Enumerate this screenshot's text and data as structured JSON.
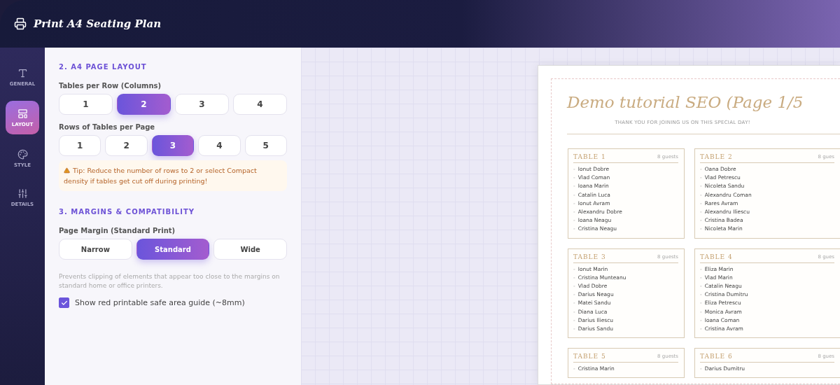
{
  "header": {
    "title": "Print A4 Seating Plan"
  },
  "sidebar": {
    "items": [
      {
        "label": "GENERAL",
        "selected": false
      },
      {
        "label": "LAYOUT",
        "selected": true
      },
      {
        "label": "STYLE",
        "selected": false
      },
      {
        "label": "DETAILS",
        "selected": false
      }
    ]
  },
  "settings": {
    "layout_heading": "2. A4 PAGE LAYOUT",
    "columns": {
      "label": "Tables per Row (Columns)",
      "options": [
        {
          "label": "1",
          "selected": false
        },
        {
          "label": "2",
          "selected": true
        },
        {
          "label": "3",
          "selected": false
        },
        {
          "label": "4",
          "selected": false
        }
      ]
    },
    "rows": {
      "label": "Rows of Tables per Page",
      "options": [
        {
          "label": "1",
          "selected": false
        },
        {
          "label": "2",
          "selected": false
        },
        {
          "label": "3",
          "selected": true
        },
        {
          "label": "4",
          "selected": false
        },
        {
          "label": "5",
          "selected": false
        }
      ]
    },
    "tip": "Tip: Reduce the number of rows to 2 or select Compact density if tables get cut off during printing!",
    "margins_heading": "3. MARGINS & COMPATIBILITY",
    "margin": {
      "label": "Page Margin (Standard Print)",
      "options": [
        {
          "label": "Narrow",
          "selected": false
        },
        {
          "label": "Standard",
          "selected": true
        },
        {
          "label": "Wide",
          "selected": false
        }
      ]
    },
    "margin_hint": "Prevents clipping of elements that appear too close to the margins on standard home or office printers.",
    "safe_area": {
      "label": "Show red printable safe area guide (~8mm)",
      "checked": true
    }
  },
  "preview": {
    "title": "Demo tutorial SEO (Page 1/5",
    "subtitle": "THANK YOU FOR JOINING US ON THIS SPECIAL DAY!",
    "tables": [
      {
        "name": "TABLE 1",
        "count": "8 guests",
        "guests": [
          "Ionut Dobre",
          "Vlad Coman",
          "Ioana Marin",
          "Catalin Luca",
          "Ionut Avram",
          "Alexandru Dobre",
          "Ioana Neagu",
          "Cristina Neagu"
        ]
      },
      {
        "name": "TABLE 2",
        "count": "8 gues",
        "guests": [
          "Oana Dobre",
          "Vlad Petrescu",
          "Nicoleta Sandu",
          "Alexandru Coman",
          "Rares Avram",
          "Alexandru Iliescu",
          "Cristina Badea",
          "Nicoleta Marin"
        ]
      },
      {
        "name": "TABLE 3",
        "count": "8 guests",
        "guests": [
          "Ionut Marin",
          "Cristina Munteanu",
          "Vlad Dobre",
          "Darius Neagu",
          "Matei Sandu",
          "Diana Luca",
          "Darius Iliescu",
          "Darius Sandu"
        ]
      },
      {
        "name": "TABLE 4",
        "count": "8 gues",
        "guests": [
          "Eliza Marin",
          "Vlad Marin",
          "Catalin Neagu",
          "Cristina Dumitru",
          "Eliza Petrescu",
          "Monica Avram",
          "Ioana Coman",
          "Cristina Avram"
        ]
      },
      {
        "name": "TABLE 5",
        "count": "8 guests",
        "guests": [
          "Cristina Marin"
        ]
      },
      {
        "name": "TABLE 6",
        "count": "8 gues",
        "guests": [
          "Darius Dumitru"
        ]
      }
    ],
    "bullet": "-"
  }
}
